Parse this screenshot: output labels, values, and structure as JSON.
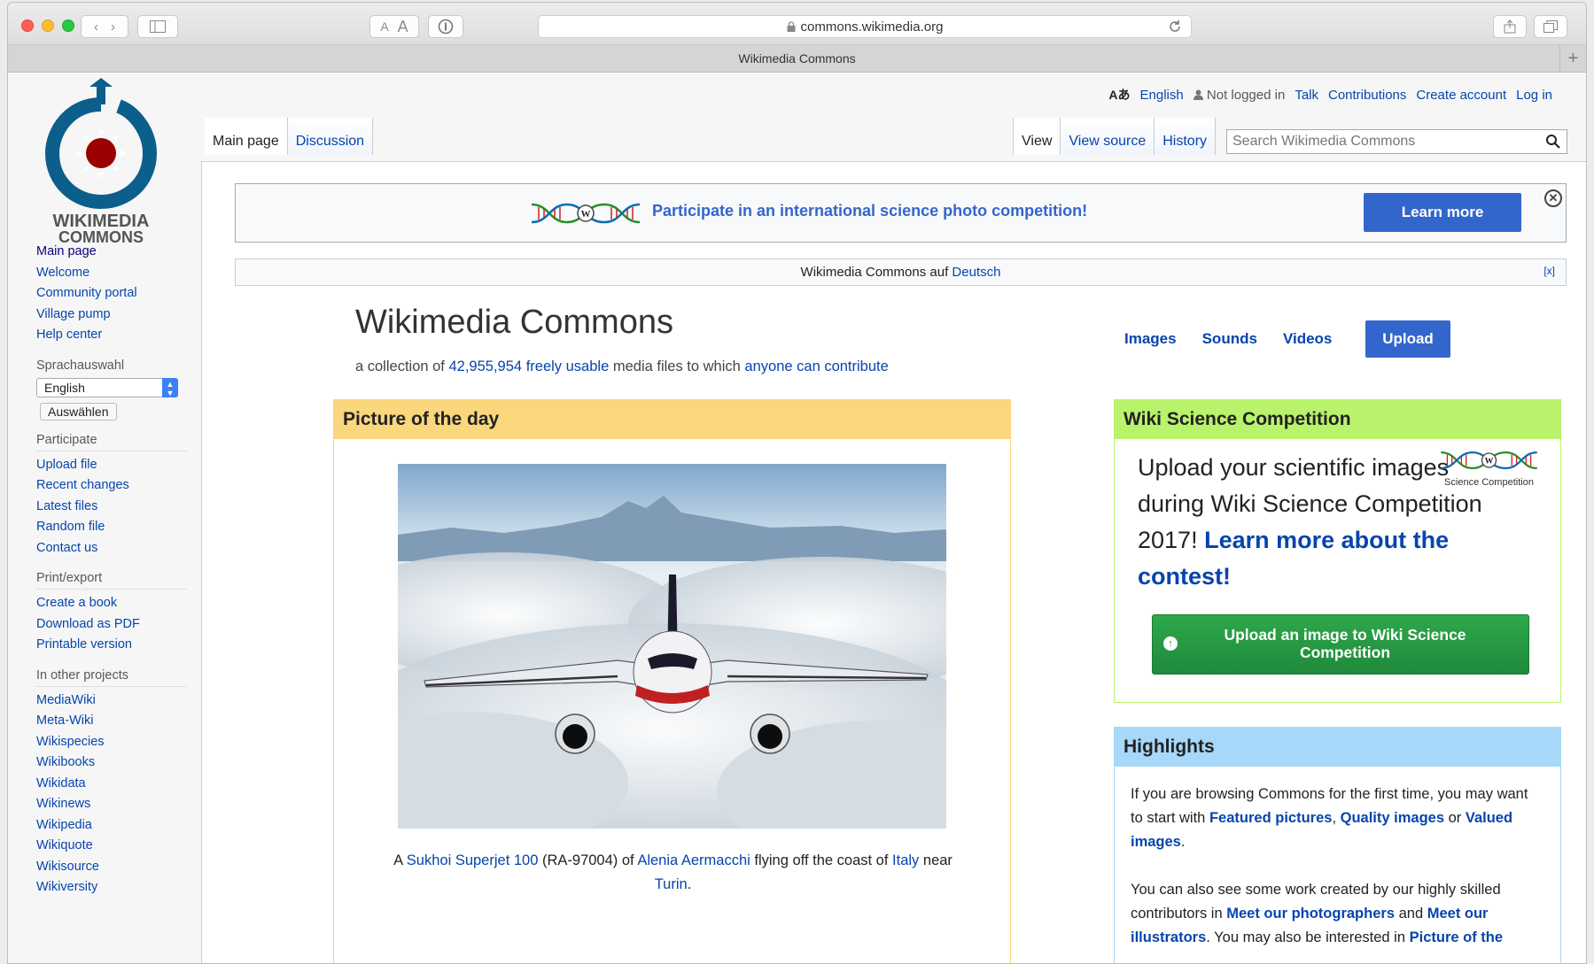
{
  "browser": {
    "url": "commons.wikimedia.org",
    "tab_title": "Wikimedia Commons",
    "text_size_small": "A",
    "text_size_large": "A"
  },
  "logo": {
    "line1": "WIKIMEDIA",
    "line2": "COMMONS"
  },
  "personal": {
    "language_icon": "Aあ",
    "language": "English",
    "not_logged_in": "Not logged in",
    "talk": "Talk",
    "contributions": "Contributions",
    "create_account": "Create account",
    "login": "Log in"
  },
  "tabs": {
    "main_page": "Main page",
    "discussion": "Discussion",
    "view": "View",
    "view_source": "View source",
    "history": "History"
  },
  "search": {
    "placeholder": "Search Wikimedia Commons"
  },
  "sidebar": {
    "nav": [
      "Main page",
      "Welcome",
      "Community portal",
      "Village pump",
      "Help center"
    ],
    "language_heading": "Sprachauswahl",
    "language_selected": "English",
    "choose_button": "Auswählen",
    "participate_heading": "Participate",
    "participate": [
      "Upload file",
      "Recent changes",
      "Latest files",
      "Random file",
      "Contact us"
    ],
    "print_heading": "Print/export",
    "print": [
      "Create a book",
      "Download as PDF",
      "Printable version"
    ],
    "other_heading": "In other projects",
    "other": [
      "MediaWiki",
      "Meta-Wiki",
      "Wikispecies",
      "Wikibooks",
      "Wikidata",
      "Wikinews",
      "Wikipedia",
      "Wikiquote",
      "Wikisource",
      "Wikiversity"
    ]
  },
  "banner": {
    "text": "Participate in an international science photo competition!",
    "button": "Learn more",
    "close": "✕"
  },
  "langbar": {
    "prefix": "Wikimedia Commons auf",
    "link": "Deutsch",
    "close": "[x]"
  },
  "main": {
    "title": "Wikimedia Commons",
    "subtitle_1": "a collection of",
    "count": "42,955,954",
    "freely_usable": "freely usable",
    "subtitle_2": "media files to which",
    "anyone": "anyone can contribute",
    "images": "Images",
    "sounds": "Sounds",
    "videos": "Videos",
    "upload": "Upload"
  },
  "potd": {
    "heading": "Picture of the day",
    "cap_a": "A",
    "cap_link1": "Sukhoi Superjet 100",
    "cap_mid1": "(RA-97004) of",
    "cap_link2": "Alenia Aermacchi",
    "cap_mid2": "flying off the coast of",
    "cap_link3": "Italy",
    "cap_mid3": "near",
    "cap_link4": "Turin",
    "cap_end": "."
  },
  "wsc": {
    "heading": "Wiki Science Competition",
    "text": "Upload your scientific images during Wiki Science Competition 2017!",
    "link": "Learn more about the contest!",
    "logo_caption": "Science Competition",
    "button": "Upload an image to Wiki Science Competition"
  },
  "highlights": {
    "heading": "Highlights",
    "p1_a": "If you are browsing Commons for the first time, you may want to start with",
    "featured": "Featured pictures",
    "comma": ",",
    "quality": "Quality images",
    "or": "or",
    "valued": "Valued images",
    "period": ".",
    "p2_a": "You can also see some work created by our highly skilled contributors in",
    "photographers": "Meet our photographers",
    "and": "and",
    "illustrators": "Meet our illustrators",
    "p2_b": ". You may also be interested in",
    "potd_link": "Picture of the"
  }
}
